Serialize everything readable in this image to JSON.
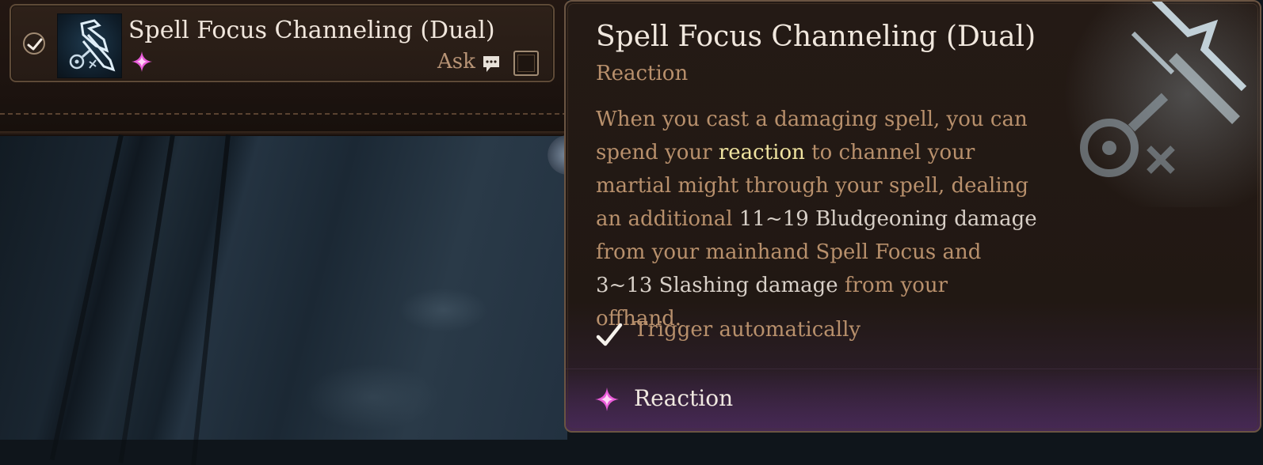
{
  "row": {
    "title": "Spell Focus Channeling (Dual)",
    "ask_label": "Ask",
    "selected": true,
    "toggle_checked": false,
    "icons": {
      "check": "checkmark-circle-icon",
      "spell": "spell-focus-channeling-icon",
      "resource": "reaction-star-icon",
      "ask": "speech-bubble-icon"
    }
  },
  "tooltip": {
    "title": "Spell Focus Channeling (Dual)",
    "subtitle": "Reaction",
    "description": {
      "p1": "When you cast a damaging spell, you can spend your ",
      "keyword": "reaction",
      "p2": " to channel your martial might through your spell, dealing an additional ",
      "dmg1": "11~19 Bludgeoning damage",
      "p3": " from your mainhand Spell Focus and ",
      "dmg2": "3~13 Slashing damage",
      "p4": " from your offhand."
    },
    "trigger_label": "Trigger automatically",
    "footer_label": "Reaction"
  },
  "colors": {
    "accent_gold": "#b8906c",
    "keyword_yellow": "#efe3a0",
    "reaction_pink": "#e85ad8"
  }
}
